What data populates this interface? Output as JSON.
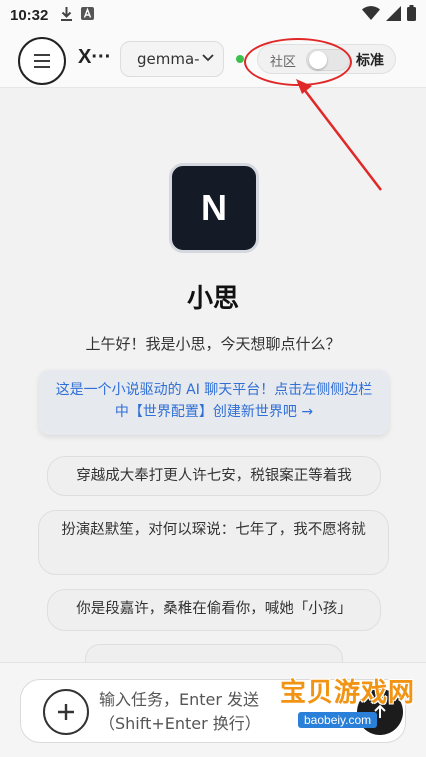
{
  "status_bar": {
    "time": "10:32",
    "icons": [
      "download-icon",
      "notification-a-icon",
      "wifi-icon",
      "signal-icon",
      "battery-icon"
    ]
  },
  "header": {
    "app_title": "X···",
    "model_selected": "gemma-",
    "community_label": "社区",
    "community_toggle_on": false,
    "standard_label": "标准",
    "status_dot_color": "#3cc04e"
  },
  "main": {
    "avatar_letter": "N",
    "bot_name": "小思",
    "greeting": "上午好！我是小思，今天想聊点什么？",
    "info": "这是一个小说驱动的 AI 聊天平台！点击左侧侧边栏中【世界配置】创建新世界吧 →",
    "suggestions": [
      "穿越成大奉打更人许七安，税银案正等着我",
      "扮演赵默笙，对何以琛说：七年了，我不愿将就",
      "你是段嘉许，桑稚在偷看你，喊她「小孩」",
      ""
    ]
  },
  "input": {
    "placeholder_line1": "输入任务，Enter 发送",
    "placeholder_line2": "（Shift+Enter 换行）"
  },
  "watermark": {
    "text": "宝贝游戏网",
    "url": "baobeiy.com"
  },
  "colors": {
    "accent_blue": "#2f6fd6",
    "annotation_red": "#e02828",
    "avatar_bg": "#141a26"
  }
}
